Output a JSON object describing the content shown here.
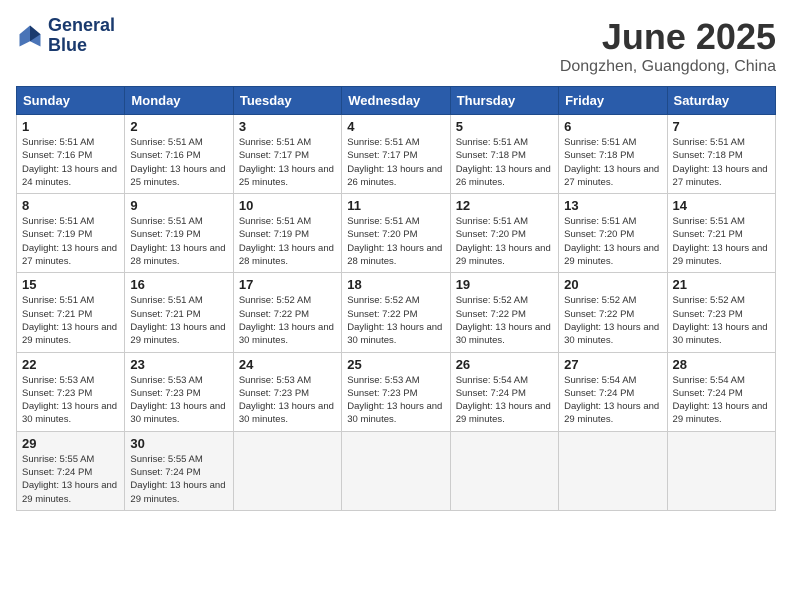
{
  "logo": {
    "line1": "General",
    "line2": "Blue"
  },
  "title": "June 2025",
  "location": "Dongzhen, Guangdong, China",
  "weekdays": [
    "Sunday",
    "Monday",
    "Tuesday",
    "Wednesday",
    "Thursday",
    "Friday",
    "Saturday"
  ],
  "weeks": [
    [
      {
        "day": 1,
        "sunrise": "5:51 AM",
        "sunset": "7:16 PM",
        "daylight": "13 hours and 24 minutes."
      },
      {
        "day": 2,
        "sunrise": "5:51 AM",
        "sunset": "7:16 PM",
        "daylight": "13 hours and 25 minutes."
      },
      {
        "day": 3,
        "sunrise": "5:51 AM",
        "sunset": "7:17 PM",
        "daylight": "13 hours and 25 minutes."
      },
      {
        "day": 4,
        "sunrise": "5:51 AM",
        "sunset": "7:17 PM",
        "daylight": "13 hours and 26 minutes."
      },
      {
        "day": 5,
        "sunrise": "5:51 AM",
        "sunset": "7:18 PM",
        "daylight": "13 hours and 26 minutes."
      },
      {
        "day": 6,
        "sunrise": "5:51 AM",
        "sunset": "7:18 PM",
        "daylight": "13 hours and 27 minutes."
      },
      {
        "day": 7,
        "sunrise": "5:51 AM",
        "sunset": "7:18 PM",
        "daylight": "13 hours and 27 minutes."
      }
    ],
    [
      {
        "day": 8,
        "sunrise": "5:51 AM",
        "sunset": "7:19 PM",
        "daylight": "13 hours and 27 minutes."
      },
      {
        "day": 9,
        "sunrise": "5:51 AM",
        "sunset": "7:19 PM",
        "daylight": "13 hours and 28 minutes."
      },
      {
        "day": 10,
        "sunrise": "5:51 AM",
        "sunset": "7:19 PM",
        "daylight": "13 hours and 28 minutes."
      },
      {
        "day": 11,
        "sunrise": "5:51 AM",
        "sunset": "7:20 PM",
        "daylight": "13 hours and 28 minutes."
      },
      {
        "day": 12,
        "sunrise": "5:51 AM",
        "sunset": "7:20 PM",
        "daylight": "13 hours and 29 minutes."
      },
      {
        "day": 13,
        "sunrise": "5:51 AM",
        "sunset": "7:20 PM",
        "daylight": "13 hours and 29 minutes."
      },
      {
        "day": 14,
        "sunrise": "5:51 AM",
        "sunset": "7:21 PM",
        "daylight": "13 hours and 29 minutes."
      }
    ],
    [
      {
        "day": 15,
        "sunrise": "5:51 AM",
        "sunset": "7:21 PM",
        "daylight": "13 hours and 29 minutes."
      },
      {
        "day": 16,
        "sunrise": "5:51 AM",
        "sunset": "7:21 PM",
        "daylight": "13 hours and 29 minutes."
      },
      {
        "day": 17,
        "sunrise": "5:52 AM",
        "sunset": "7:22 PM",
        "daylight": "13 hours and 30 minutes."
      },
      {
        "day": 18,
        "sunrise": "5:52 AM",
        "sunset": "7:22 PM",
        "daylight": "13 hours and 30 minutes."
      },
      {
        "day": 19,
        "sunrise": "5:52 AM",
        "sunset": "7:22 PM",
        "daylight": "13 hours and 30 minutes."
      },
      {
        "day": 20,
        "sunrise": "5:52 AM",
        "sunset": "7:22 PM",
        "daylight": "13 hours and 30 minutes."
      },
      {
        "day": 21,
        "sunrise": "5:52 AM",
        "sunset": "7:23 PM",
        "daylight": "13 hours and 30 minutes."
      }
    ],
    [
      {
        "day": 22,
        "sunrise": "5:53 AM",
        "sunset": "7:23 PM",
        "daylight": "13 hours and 30 minutes."
      },
      {
        "day": 23,
        "sunrise": "5:53 AM",
        "sunset": "7:23 PM",
        "daylight": "13 hours and 30 minutes."
      },
      {
        "day": 24,
        "sunrise": "5:53 AM",
        "sunset": "7:23 PM",
        "daylight": "13 hours and 30 minutes."
      },
      {
        "day": 25,
        "sunrise": "5:53 AM",
        "sunset": "7:23 PM",
        "daylight": "13 hours and 30 minutes."
      },
      {
        "day": 26,
        "sunrise": "5:54 AM",
        "sunset": "7:24 PM",
        "daylight": "13 hours and 29 minutes."
      },
      {
        "day": 27,
        "sunrise": "5:54 AM",
        "sunset": "7:24 PM",
        "daylight": "13 hours and 29 minutes."
      },
      {
        "day": 28,
        "sunrise": "5:54 AM",
        "sunset": "7:24 PM",
        "daylight": "13 hours and 29 minutes."
      }
    ],
    [
      {
        "day": 29,
        "sunrise": "5:55 AM",
        "sunset": "7:24 PM",
        "daylight": "13 hours and 29 minutes."
      },
      {
        "day": 30,
        "sunrise": "5:55 AM",
        "sunset": "7:24 PM",
        "daylight": "13 hours and 29 minutes."
      },
      null,
      null,
      null,
      null,
      null
    ]
  ]
}
